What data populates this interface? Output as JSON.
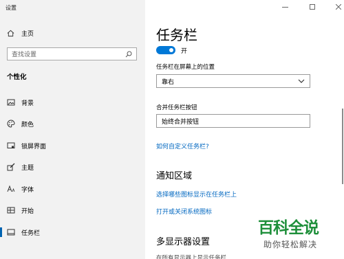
{
  "window": {
    "title": "设置"
  },
  "sidebar": {
    "home_label": "主页",
    "search_placeholder": "查找设置",
    "section_heading": "个性化",
    "items": [
      {
        "label": "背景",
        "icon": "image-icon"
      },
      {
        "label": "颜色",
        "icon": "palette-icon"
      },
      {
        "label": "锁屏界面",
        "icon": "lockscreen-icon"
      },
      {
        "label": "主题",
        "icon": "theme-brush-icon"
      },
      {
        "label": "字体",
        "icon": "font-icon"
      },
      {
        "label": "开始",
        "icon": "start-grid-icon"
      },
      {
        "label": "任务栏",
        "icon": "taskbar-icon",
        "active": true
      }
    ]
  },
  "main": {
    "title": "任务栏",
    "toggle": {
      "state": "开",
      "on": true
    },
    "position_label": "任务栏在屏幕上的位置",
    "position_value": "靠右",
    "combine_label": "合并任务栏按钮",
    "combine_value": "始终合并按钮",
    "customize_link": "如何自定义任务栏?",
    "notification_heading": "通知区域",
    "notification_links": [
      "选择哪些图标显示在任务栏上",
      "打开或关闭系统图标"
    ],
    "multi_display_heading": "多显示器设置",
    "partial_text": "在所有显示器上显示任务栏"
  },
  "watermark": {
    "main": "百科全说",
    "sub": "助你轻松解决"
  },
  "colors": {
    "accent": "#0078d7",
    "link": "#0067c0",
    "sidebar_bg": "#f2f2f2",
    "watermark_green": "#1e8f3a"
  }
}
